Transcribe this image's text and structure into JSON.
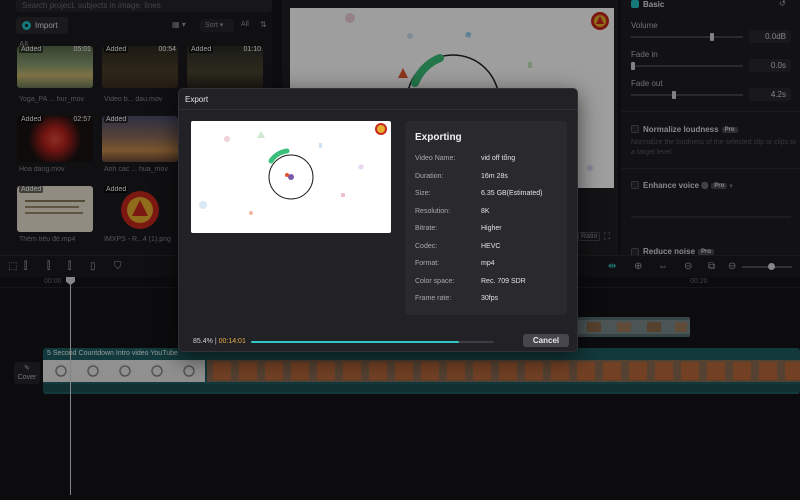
{
  "media": {
    "search_placeholder": "Search project, subjects in image, lines",
    "import_label": "Import",
    "sort_label": "Sort",
    "all_button": "All",
    "filter_icon": "filter-icon",
    "all_label": "All",
    "items": [
      {
        "badge": "Added",
        "duration": "05:01",
        "label": "Yoga_PA ... hur_mov"
      },
      {
        "badge": "Added",
        "duration": "00:54",
        "label": "Video b... dau.mov"
      },
      {
        "badge": "Added",
        "duration": "01:10",
        "label": ""
      },
      {
        "badge": "Added",
        "duration": "02:57",
        "label": "Hoa dang.mov"
      },
      {
        "badge": "Added",
        "duration": "",
        "label": "Anh cac ... hua_mov"
      },
      {
        "badge": "Added",
        "duration": "",
        "label": ""
      },
      {
        "badge": "Added",
        "duration": "",
        "label": "Thêm tiêu đề.mp4"
      },
      {
        "badge": "Added",
        "duration": "",
        "label": "IMXPS - R...4 (1).png"
      }
    ]
  },
  "preview": {
    "ratio_label": "Ratio"
  },
  "props": {
    "section": "Basic",
    "volume_label": "Volume",
    "volume_value": "0.0dB",
    "volume_level": 0.72,
    "fade_in_label": "Fade in",
    "fade_in_value": "0.0s",
    "fade_in_level": 0.0,
    "fade_out_label": "Fade out",
    "fade_out_value": "4.2s",
    "fade_out_level": 0.38,
    "normalize_label": "Normalize loudness",
    "normalize_desc": "Normalize the loudness of the selected clip or clips to a target level.",
    "enhance_label": "Enhance voice",
    "reduce_label": "Reduce noise",
    "pro_badge": "Pro"
  },
  "timeline": {
    "ruler_start": "00:00",
    "ruler_end": "00:20",
    "track_title": "5 Second Countdown Intro video YouTube",
    "cover_label": "Cover"
  },
  "export": {
    "title": "Export",
    "status": "Exporting",
    "fields": [
      {
        "key": "Video Name:",
        "value": "vid off tổng"
      },
      {
        "key": "Duration:",
        "value": "16m 28s"
      },
      {
        "key": "Size:",
        "value": "6.35 GB(Estimated)"
      },
      {
        "key": "Resolution:",
        "value": "8K"
      },
      {
        "key": "Bitrate:",
        "value": "Higher"
      },
      {
        "key": "Codec:",
        "value": "HEVC"
      },
      {
        "key": "Format:",
        "value": "mp4"
      },
      {
        "key": "Color space:",
        "value": "Rec. 709 SDR"
      },
      {
        "key": "Frame rate:",
        "value": "30fps"
      }
    ],
    "progress_percent": "85.4%",
    "progress_sep": "|",
    "elapsed": "00:14:01",
    "progress_fraction": 0.854,
    "cancel_label": "Cancel"
  },
  "colors": {
    "accent": "#2ec6c6",
    "elapsed": "#e8a94a",
    "clip": "#1e5d60"
  }
}
